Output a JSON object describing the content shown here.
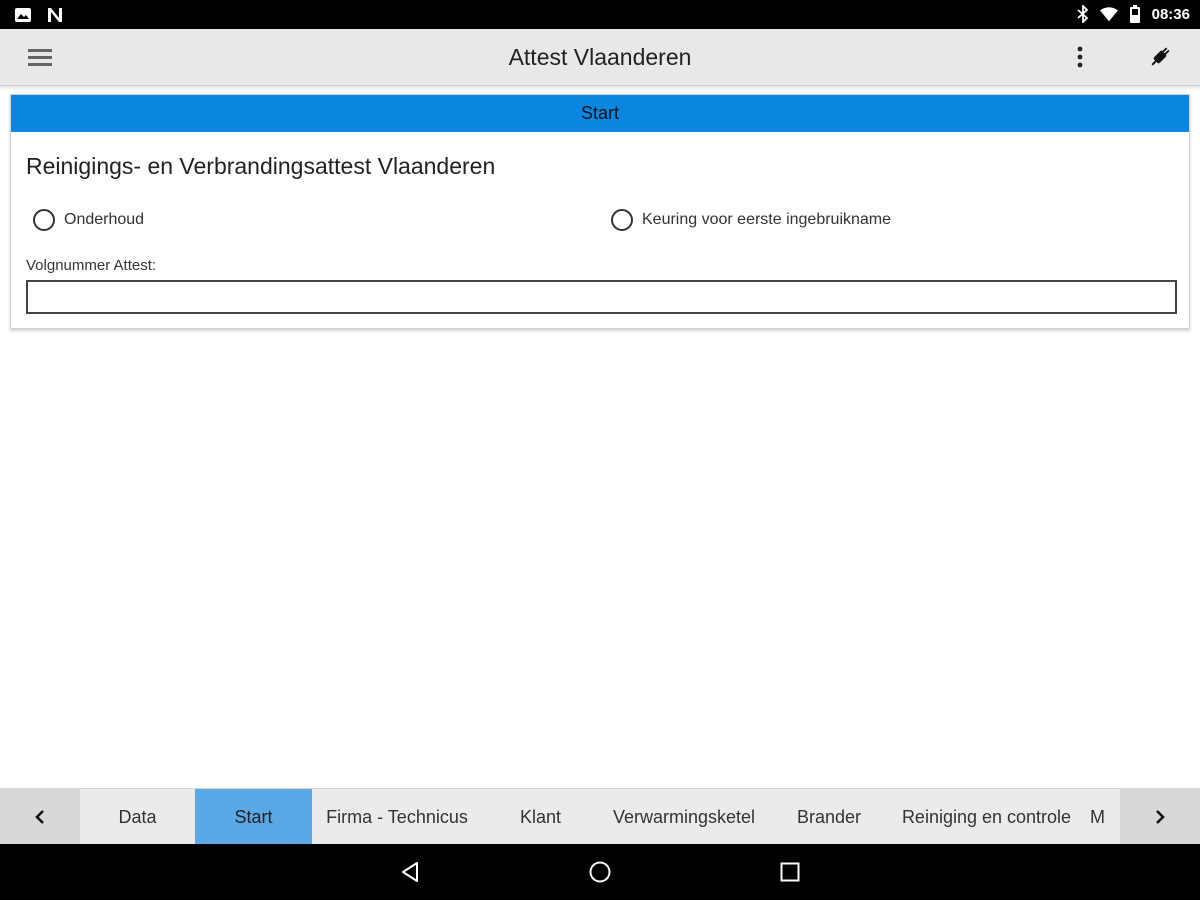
{
  "status_bar": {
    "left_icons": [
      "image-icon",
      "n-icon"
    ],
    "right_icons": [
      "bluetooth-icon",
      "wifi-icon",
      "battery-icon"
    ],
    "time": "08:36"
  },
  "app_bar": {
    "title": "Attest Vlaanderen",
    "icons": [
      "menu-icon",
      "more-vert-icon",
      "plug-icon"
    ]
  },
  "card": {
    "header": "Start",
    "title": "Reinigings- en Verbrandingsattest Vlaanderen",
    "radios": [
      {
        "label": "Onderhoud",
        "selected": false
      },
      {
        "label": "Keuring voor eerste ingebruikname",
        "selected": false
      }
    ],
    "field_label": "Volgnummer Attest:",
    "field_value": ""
  },
  "tab_bar": {
    "tabs": [
      {
        "label": "Data",
        "active": false
      },
      {
        "label": "Start",
        "active": true
      },
      {
        "label": "Firma - Technicus",
        "active": false
      },
      {
        "label": "Klant",
        "active": false
      },
      {
        "label": "Verwarmingsketel",
        "active": false
      },
      {
        "label": "Brander",
        "active": false
      },
      {
        "label": "Reiniging en controle",
        "active": false
      },
      {
        "label": "M",
        "active": false
      }
    ],
    "accent_color": "#5aa8e6"
  },
  "colors": {
    "header_blue": "#0a86e0",
    "status_bar": "#000000",
    "app_bar": "#e8e8e8"
  },
  "nav_bar": {
    "icons": [
      "back-icon",
      "home-icon",
      "recents-icon"
    ]
  }
}
